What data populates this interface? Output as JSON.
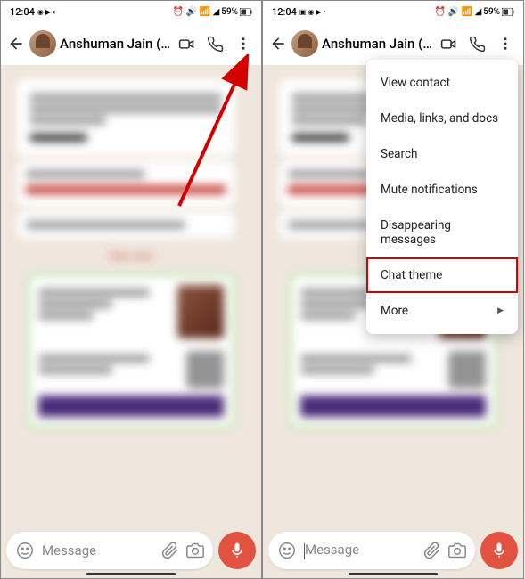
{
  "status": {
    "time": "12:04",
    "battery_text": "59%",
    "left_icons": "◉ ▶ ◐",
    "left_icons_2": "▣ ◉ ▶ •",
    "right_icons": "⏰ 🔊 📶 ◢"
  },
  "chat": {
    "contact_name": "Anshuman Jain (M...",
    "blurred_center": "View once"
  },
  "input": {
    "placeholder": "Message"
  },
  "menu": {
    "items": [
      {
        "label": "View contact"
      },
      {
        "label": "Media, links, and docs"
      },
      {
        "label": "Search"
      },
      {
        "label": "Mute notifications"
      },
      {
        "label": "Disappearing messages"
      },
      {
        "label": "Chat theme",
        "highlighted": true
      },
      {
        "label": "More",
        "hasSubmenu": true
      }
    ]
  },
  "colors": {
    "accent_mic": "#e15241",
    "highlight_box": "#d40000"
  }
}
